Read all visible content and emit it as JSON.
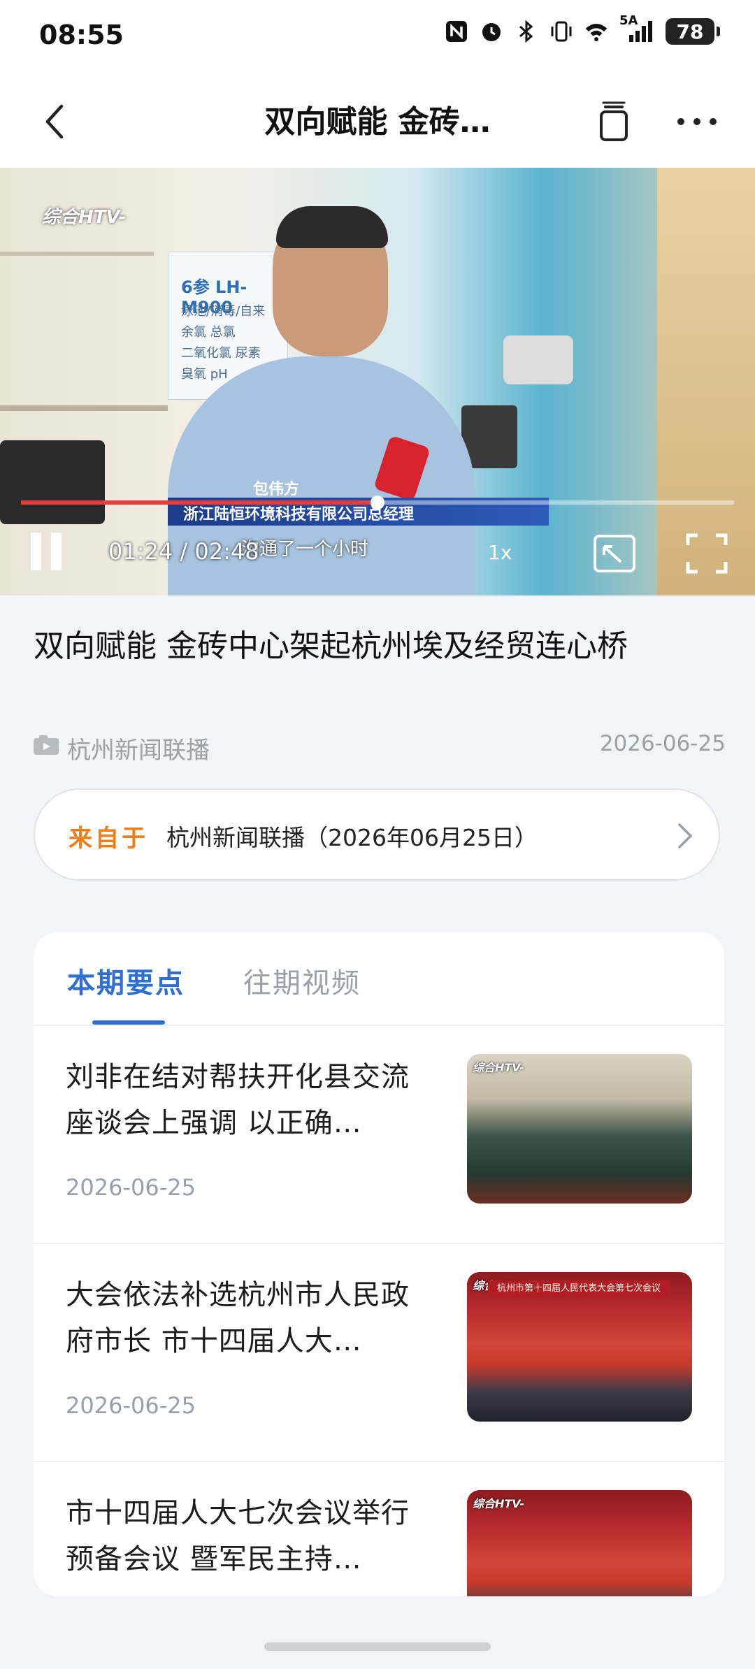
{
  "status_bar": {
    "time": "08:55",
    "network": "5A",
    "battery": "78",
    "icons": [
      "nfc-icon",
      "alarm-icon",
      "bluetooth-icon",
      "vibrate-icon",
      "wifi-icon",
      "signal-icon",
      "battery-icon"
    ]
  },
  "nav": {
    "title": "双向赋能 金砖…",
    "icons": [
      "back-icon",
      "mini-window-icon",
      "more-icon"
    ]
  },
  "video": {
    "logo": "综合HTV-",
    "poster_title": "6参 LH-M900",
    "poster_sub": [
      "泳池/消毒/自来",
      "余氯 总氯",
      "二氧化氯 尿素",
      "臭氧 pH"
    ],
    "person_name": "包伟方",
    "caption": "浙江陆恒环境科技有限公司总经理",
    "subtitle": "沟通了一个小时",
    "current_time": "01:24",
    "separator": "/",
    "duration": "02:48",
    "speed": "1x",
    "progress": 0.5
  },
  "article": {
    "title": "双向赋能 金砖中心架起杭州埃及经贸连心桥",
    "source": "杭州新闻联播",
    "date": "2026-06-25"
  },
  "from_card": {
    "label": "来自于",
    "text": "杭州新闻联播（2026年06月25日）"
  },
  "tabs": {
    "active": "本期要点",
    "inactive": "往期视频"
  },
  "items": [
    {
      "title": "刘非在结对帮扶开化县交流座谈会上强调 以正确…",
      "date": "2026-06-25",
      "thumb_tag": "综合HTV-"
    },
    {
      "title": "大会依法补选杭州市人民政府市长 市十四届人大…",
      "date": "2026-06-25",
      "thumb_tag": "综合HTV-",
      "thumb_banner": "杭州市第十四届人民代表大会第七次会议"
    },
    {
      "title": "市十四届人大七次会议举行预备会议 暨军民主持…",
      "thumb_tag": "综合HTV-"
    }
  ]
}
